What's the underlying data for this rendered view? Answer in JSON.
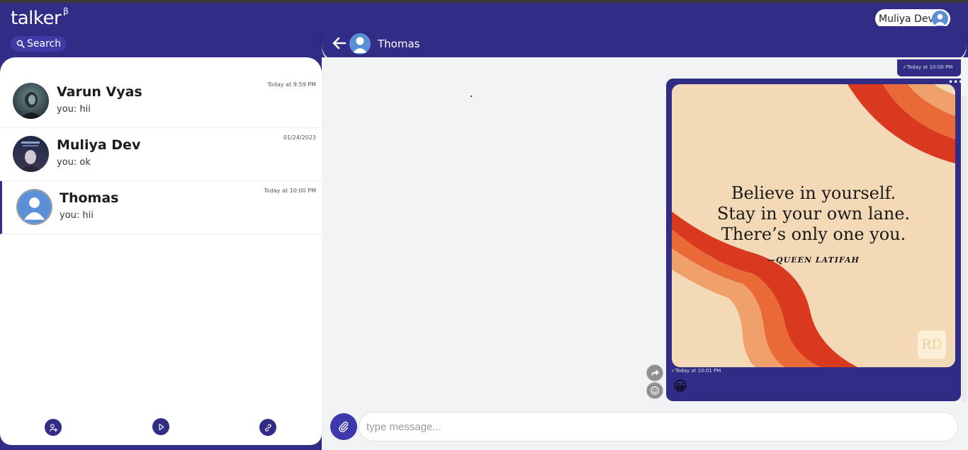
{
  "app": {
    "name": "talker",
    "badge": "β"
  },
  "search": {
    "label": "Search"
  },
  "current_user": {
    "name": "Muliya Dev"
  },
  "chats": [
    {
      "name": "Varun Vyas",
      "preview": "you: hii",
      "time": "Today at 9:59 PM"
    },
    {
      "name": "Muliya Dev",
      "preview": "you: ok",
      "time": "01/24/2023"
    },
    {
      "name": "Thomas",
      "preview": "you: hii",
      "time": "Today at 10:00 PM"
    }
  ],
  "conversation": {
    "title": "Thomas",
    "previous_message_time": "✓Today at 10:00 PM",
    "message": {
      "quote_lines": [
        "Believe in yourself.",
        "Stay in your own lane.",
        "There’s only one you."
      ],
      "quote_author": "—QUEEN LATIFAH",
      "logo_text": "RD",
      "time": "✓Today at 10:01 PM",
      "reaction": "😀",
      "more_label": "•••"
    }
  },
  "composer": {
    "placeholder": "type message..."
  },
  "colors": {
    "primary": "#312c85",
    "accent": "#3e38ad",
    "avatar": "#5b8fd8",
    "quote_bg": "#f4d9b6"
  }
}
